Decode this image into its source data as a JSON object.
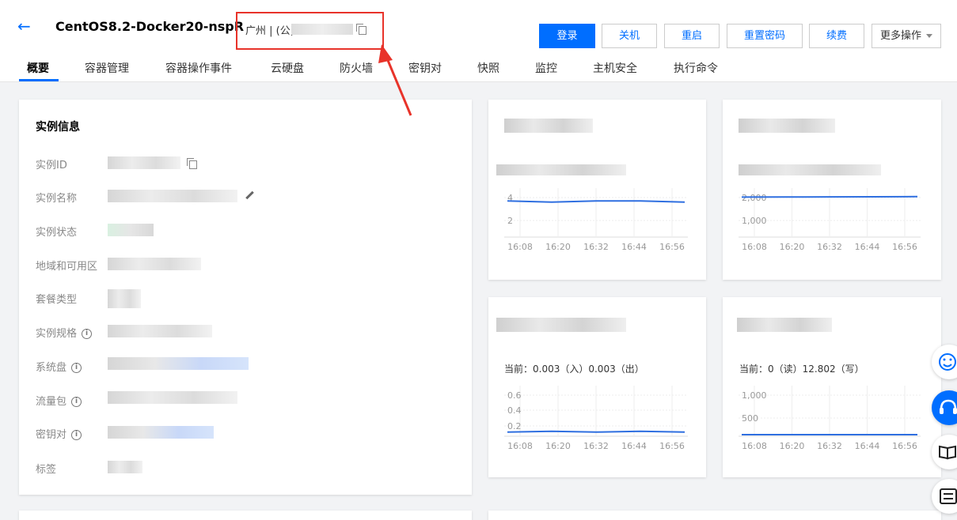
{
  "header": {
    "title": "CentOS8.2-Docker20-nspR",
    "region_prefix": "广州 | (公)",
    "buttons": {
      "login": "登录",
      "shutdown": "关机",
      "restart": "重启",
      "reset_password": "重置密码",
      "renew": "续费",
      "more": "更多操作"
    }
  },
  "tabs": [
    "概要",
    "容器管理",
    "容器操作事件",
    "云硬盘",
    "防火墙",
    "密钥对",
    "快照",
    "监控",
    "主机安全",
    "执行命令"
  ],
  "instance_info": {
    "title": "实例信息",
    "labels": {
      "id": "实例ID",
      "name": "实例名称",
      "status": "实例状态",
      "region": "地域和可用区",
      "package": "套餐类型",
      "spec": "实例规格",
      "system_disk": "系统盘",
      "traffic": "流量包",
      "key_pair": "密钥对",
      "tags": "标签"
    }
  },
  "charts": {
    "cpu": {
      "y_ticks": [
        "4",
        "2"
      ],
      "x_ticks": [
        "16:08",
        "16:20",
        "16:32",
        "16:44",
        "16:56"
      ]
    },
    "memory": {
      "y_ticks": [
        "2,000",
        "1,000"
      ],
      "x_ticks": [
        "16:08",
        "16:20",
        "16:32",
        "16:44",
        "16:56"
      ]
    },
    "network": {
      "current": "当前：0.003（入）0.003（出）",
      "y_ticks": [
        "0.6",
        "0.4",
        "0.2"
      ],
      "x_ticks": [
        "16:08",
        "16:20",
        "16:32",
        "16:44",
        "16:56"
      ]
    },
    "disk": {
      "current": "当前：0（读）12.802（写）",
      "y_ticks": [
        "1,000",
        "500"
      ],
      "x_ticks": [
        "16:08",
        "16:20",
        "16:32",
        "16:44",
        "16:56"
      ]
    }
  },
  "chart_data": [
    {
      "type": "line",
      "x": [
        "16:08",
        "16:20",
        "16:32",
        "16:44",
        "16:56"
      ],
      "ylim": [
        2,
        4
      ],
      "series": [
        {
          "values": [
            3.7,
            3.6,
            3.7,
            3.7,
            3.6
          ]
        }
      ]
    },
    {
      "type": "line",
      "x": [
        "16:08",
        "16:20",
        "16:32",
        "16:44",
        "16:56"
      ],
      "ylim": [
        1000,
        2000
      ],
      "series": [
        {
          "values": [
            2020,
            2025,
            2030,
            2035,
            2040
          ]
        }
      ]
    },
    {
      "type": "line",
      "x": [
        "16:08",
        "16:20",
        "16:32",
        "16:44",
        "16:56"
      ],
      "ylim": [
        0.2,
        0.6
      ],
      "series": [
        {
          "values": [
            0.12,
            0.13,
            0.12,
            0.13,
            0.12
          ]
        }
      ]
    },
    {
      "type": "line",
      "x": [
        "16:08",
        "16:20",
        "16:32",
        "16:44",
        "16:56"
      ],
      "ylim": [
        500,
        1000
      ],
      "series": [
        {
          "values": [
            0,
            0,
            13,
            0,
            0
          ]
        }
      ]
    }
  ],
  "colors": {
    "accent": "#006eff",
    "annotation": "#e8332a"
  }
}
